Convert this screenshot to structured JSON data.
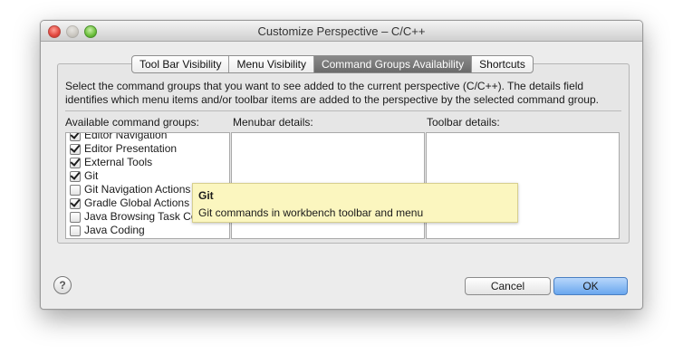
{
  "window": {
    "title": "Customize Perspective – C/C++"
  },
  "tabs": [
    {
      "label": "Tool Bar Visibility",
      "active": false
    },
    {
      "label": "Menu Visibility",
      "active": false
    },
    {
      "label": "Command Groups Availability",
      "active": true
    },
    {
      "label": "Shortcuts",
      "active": false
    }
  ],
  "description": {
    "line1": "Select the command groups that you want to see added to the current perspective (C/C++).  The details field",
    "line2": "identifies which menu items and/or toolbar items are added to the perspective by the selected command group."
  },
  "labels": {
    "groups": "Available command groups:",
    "menubar": "Menubar details:",
    "toolbar": "Toolbar details:"
  },
  "groups": [
    {
      "label": "Editor Navigation",
      "checked": true
    },
    {
      "label": "Editor Presentation",
      "checked": true
    },
    {
      "label": "External Tools",
      "checked": true
    },
    {
      "label": "Git",
      "checked": true
    },
    {
      "label": "Git Navigation Actions",
      "checked": false
    },
    {
      "label": "Gradle Global Actions",
      "checked": true
    },
    {
      "label": "Java Browsing Task Co",
      "checked": false
    },
    {
      "label": "Java Coding",
      "checked": false
    }
  ],
  "tooltip": {
    "title": "Git",
    "body": "Git commands in workbench toolbar and menu"
  },
  "buttons": {
    "help": "?",
    "cancel": "Cancel",
    "ok": "OK"
  },
  "colors": {
    "active_tab": "#7a7a7a",
    "default_button": "#6aa7ee",
    "tooltip_bg": "#fbf6bf"
  }
}
